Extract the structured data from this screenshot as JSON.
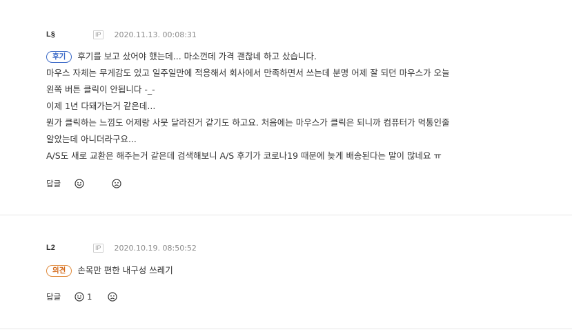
{
  "comments": [
    {
      "nickname": "L§",
      "ip_label": "IP",
      "date": "2020.11.13. 00:08:31",
      "tag": "후기",
      "lines": [
        "후기를 보고 샀어야 했는데... 마소껀데 가격 괜찮네 하고 샀습니다.",
        "마우스 자체는 무게감도 있고 일주일만에 적응해서 회사에서 만족하면서 쓰는데 분명 어제 잘 되던 마우스가 오늘",
        "왼쪽 버튼 클릭이 안됩니다 -_-",
        "이제 1년 다돼가는거 같은데...",
        "뭔가 클릭하는 느낌도 어제랑 사뭇 달라진거 같기도 하고요. 처음에는 마우스가 클릭은 되니까 컴퓨터가 먹통인줄",
        "알았는데 아니더라구요...",
        "A/S도 새로 교환은 해주는거 같은데 검색해보니 A/S 후기가 코로나19 때문에 늦게 배송된다는 말이 많네요 ㅠ"
      ],
      "reply_label": "답글",
      "like_count": "",
      "dislike_count": ""
    },
    {
      "nickname": "L2",
      "ip_label": "IP",
      "date": "2020.10.19. 08:50:52",
      "tag": "의견",
      "lines": [
        "손목만 편한 내구성 쓰레기"
      ],
      "reply_label": "답글",
      "like_count": "1",
      "dislike_count": ""
    }
  ],
  "icons": {
    "like": "smile-face-icon",
    "dislike": "frown-face-icon"
  },
  "colors": {
    "review_tag": "#3a69c7",
    "opinion_tag": "#d46a1a",
    "meta_gray": "#8a8a8a",
    "divider": "#e6e6e6"
  }
}
